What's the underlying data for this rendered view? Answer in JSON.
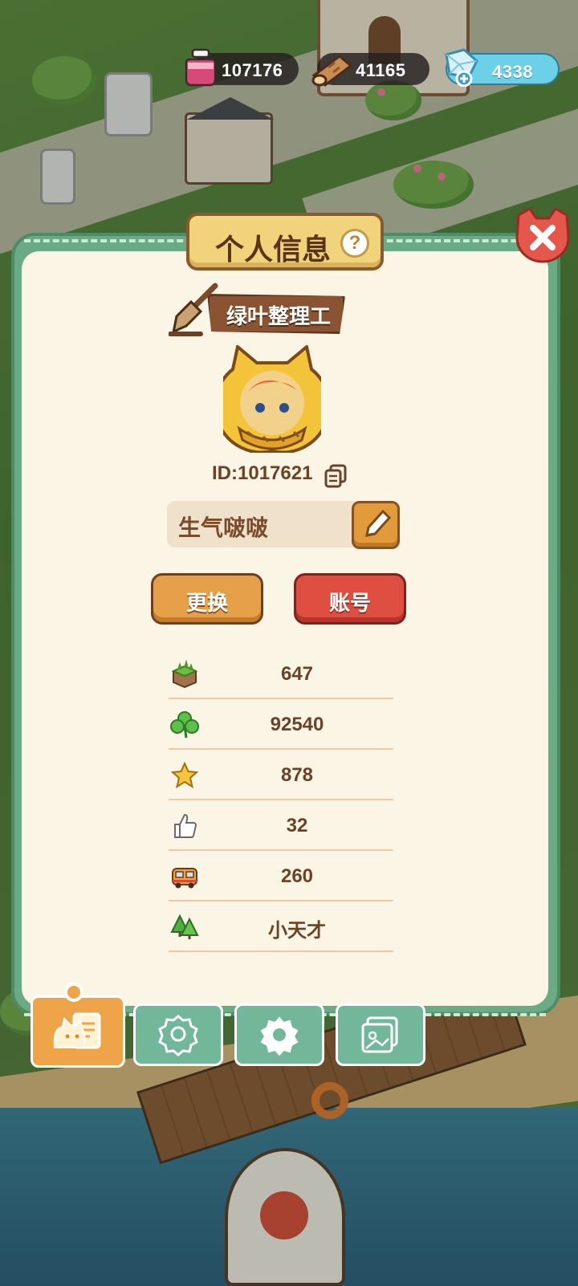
{
  "resources": {
    "ink": "107176",
    "wood": "41165",
    "gems": "4338"
  },
  "panel": {
    "title": "个人信息",
    "help_symbol": "?",
    "rank_title": "绿叶整理工",
    "player_id": "ID:1017621",
    "player_name": "生气啵啵",
    "change_label": "更换",
    "account_label": "账号"
  },
  "stats": [
    {
      "icon": "grass-block-icon",
      "value": "647"
    },
    {
      "icon": "clover-icon",
      "value": "92540"
    },
    {
      "icon": "star-icon",
      "value": "878"
    },
    {
      "icon": "thumbs-up-icon",
      "value": "32"
    },
    {
      "icon": "bus-icon",
      "value": "260"
    },
    {
      "icon": "trees-icon",
      "value": "小天才"
    }
  ],
  "tabs": [
    {
      "icon": "cat-profile-icon",
      "active": true
    },
    {
      "icon": "badge-medal-icon",
      "active": false
    },
    {
      "icon": "gear-settings-icon",
      "active": false
    },
    {
      "icon": "photo-album-icon",
      "active": false
    }
  ],
  "colors": {
    "panel_green": "#6aaa84",
    "panel_cream": "#fbf5e6",
    "button_orange": "#e7a04a",
    "button_red": "#de4f42",
    "text_brown": "#6b4226",
    "gem_blue": "#6cd0e8"
  }
}
